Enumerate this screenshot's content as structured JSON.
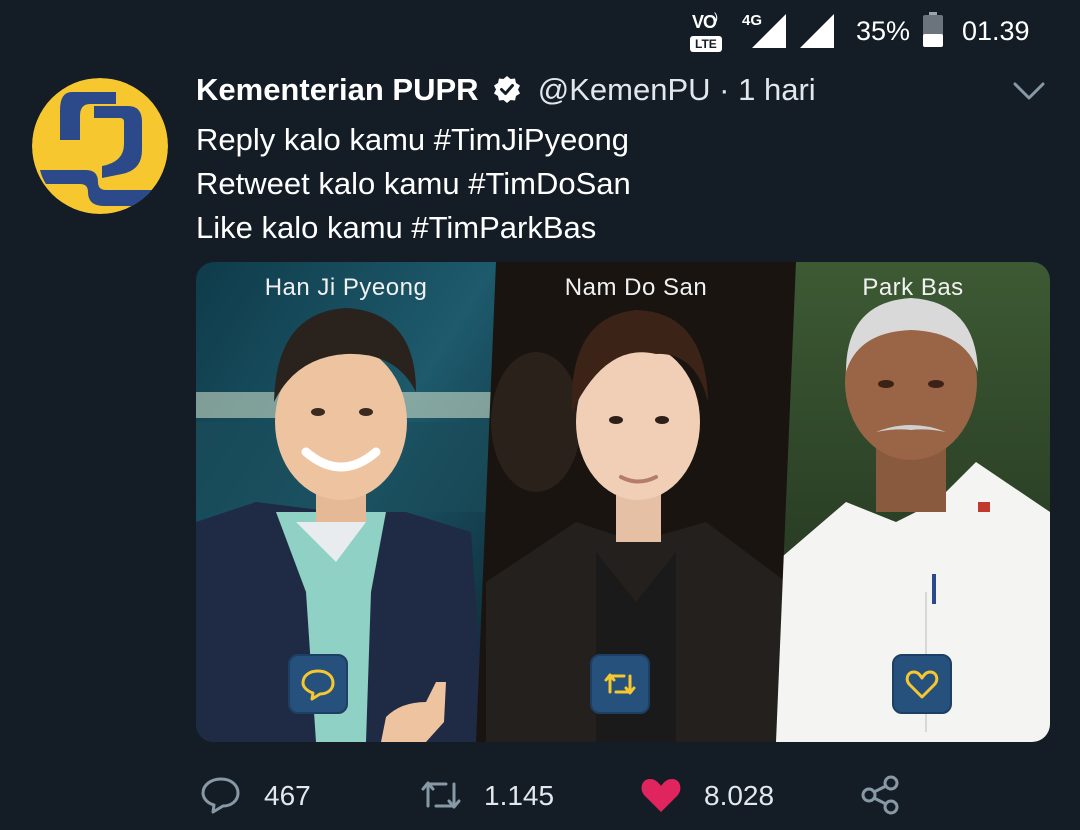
{
  "status_bar": {
    "network_badge": "VO",
    "network_sub": "LTE",
    "network_type": "4G",
    "battery": "35%",
    "time": "01.39"
  },
  "tweet": {
    "author_name": "Kementerian PUPR",
    "handle": "@KemenPU",
    "separator": "·",
    "time_ago": "1 hari",
    "lines": [
      "Reply kalo kamu #TimJiPyeong",
      "Retweet kalo kamu #TimDoSan",
      "Like kalo kamu #TimParkBas"
    ],
    "media": {
      "panels": [
        {
          "name": "Han Ji Pyeong",
          "action_icon": "reply-bubble-icon"
        },
        {
          "name": "Nam Do San",
          "action_icon": "retweet-icon"
        },
        {
          "name": "Park Bas",
          "action_icon": "heart-icon"
        }
      ]
    },
    "actions": {
      "reply_count": "467",
      "retweet_count": "1.145",
      "like_count": "8.028",
      "like_color": "#e0245e",
      "share_icon": "share-icon"
    }
  },
  "colors": {
    "background": "#141d26",
    "avatar_yellow": "#f7c730",
    "avatar_blue": "#2c4a8a",
    "panel_button": "#25517c"
  }
}
